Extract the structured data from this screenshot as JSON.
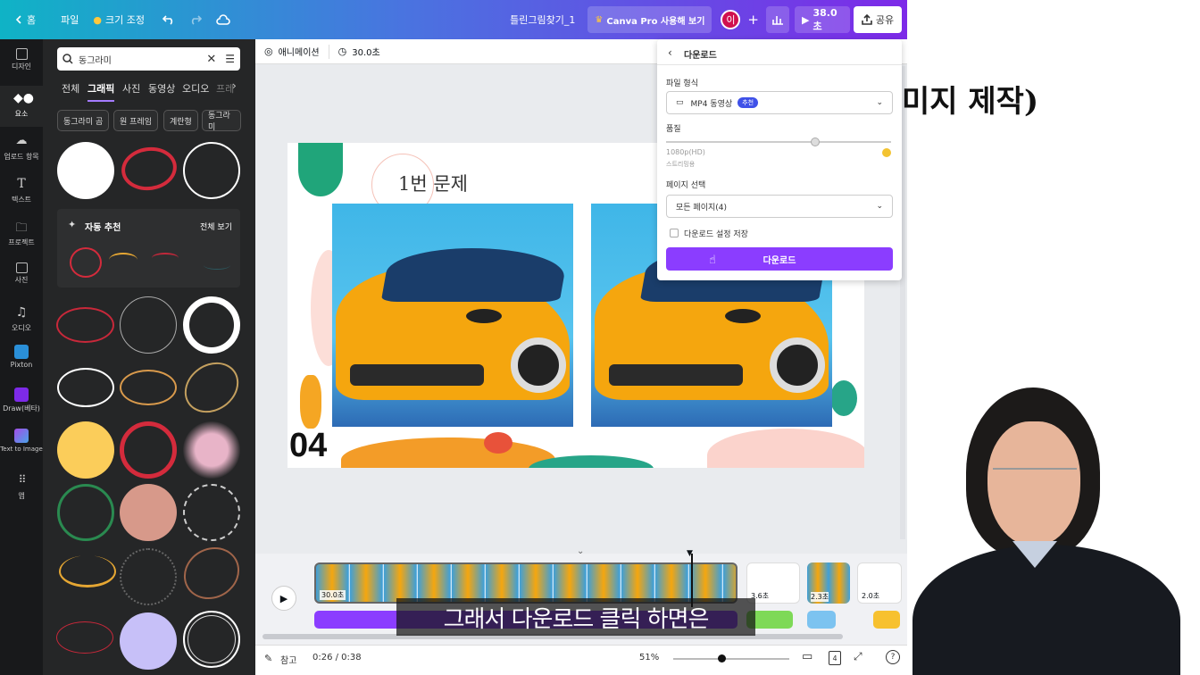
{
  "topbar": {
    "home": "홈",
    "file": "파일",
    "resize": "크기 조정",
    "doc_title": "틀린그림찾기_1",
    "pro_button": "Canva Pro 사용해 보기",
    "avatar": "이",
    "present_time": "38.0초",
    "share": "공유"
  },
  "rail": [
    {
      "label": "디자인",
      "icon": "layout-icon"
    },
    {
      "label": "요소",
      "icon": "shapes-icon"
    },
    {
      "label": "업로드 항목",
      "icon": "cloud-upload-icon"
    },
    {
      "label": "텍스트",
      "icon": "text-icon"
    },
    {
      "label": "프로젝트",
      "icon": "folder-icon"
    },
    {
      "label": "사진",
      "icon": "image-icon"
    },
    {
      "label": "오디오",
      "icon": "music-icon"
    },
    {
      "label": "Pixton",
      "icon": "pixton-icon"
    },
    {
      "label": "Draw(베타)",
      "icon": "draw-icon"
    },
    {
      "label": "Text to Image",
      "icon": "text-to-image-icon"
    },
    {
      "label": "앱",
      "icon": "apps-icon"
    }
  ],
  "panel": {
    "search_value": "동그라미",
    "tabs": [
      "전체",
      "그래픽",
      "사진",
      "동영상",
      "오디오",
      "프레"
    ],
    "chips": [
      "동그라미 곰",
      "원 프레임",
      "계란형",
      "동그라미"
    ],
    "auto_suggest": "자동 추천",
    "see_all": "전체 보기"
  },
  "canvas_bar": {
    "animate": "애니메이션",
    "duration": "30.0초"
  },
  "slide": {
    "title": "1번 문제",
    "number": "04"
  },
  "download": {
    "header": "다운로드",
    "file_type_label": "파일 형식",
    "file_type_value": "MP4 동영상",
    "recommended": "추천",
    "quality_label": "품질",
    "quality_value": "1080p(HD)",
    "quality_sub": "스트리밍용",
    "pages_label": "페이지 선택",
    "pages_value": "모든 페이지(4)",
    "save_settings": "다운로드 설정 저장",
    "button": "다운로드"
  },
  "timeline": {
    "clips": [
      {
        "duration": "30.0초"
      },
      {
        "duration": "3.6초"
      },
      {
        "duration": "2.3초"
      },
      {
        "duration": "2.0초"
      }
    ]
  },
  "bottom": {
    "notes": "참고",
    "time": "0:26 / 0:38",
    "zoom": "51%",
    "pages_count": "4"
  },
  "caption": "그래서 다운로드 클릭 하면은",
  "right_heading": "미지 제작)",
  "colors": {
    "accent_purple": "#8b3dff",
    "rail_bg": "#18191b",
    "panel_bg": "#252627"
  }
}
